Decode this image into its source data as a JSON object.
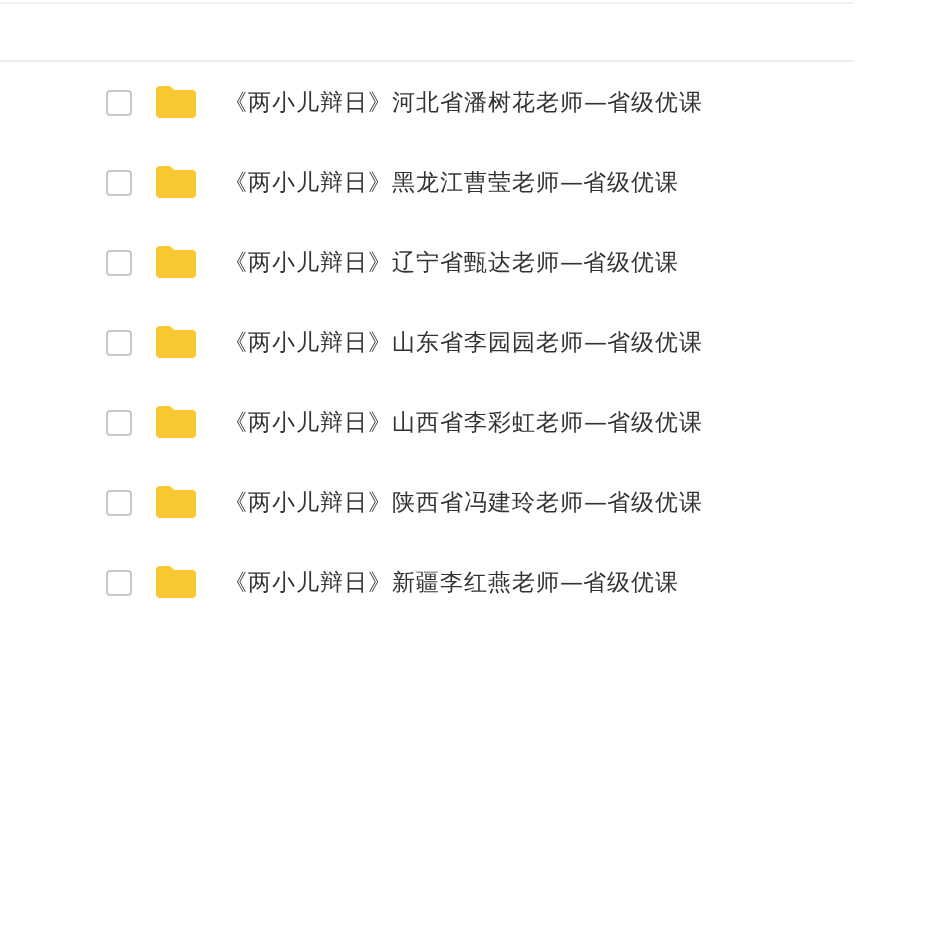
{
  "files": [
    {
      "name": "《两小儿辩日》河北省潘树花老师—省级优课",
      "kind": "folder",
      "checked": false
    },
    {
      "name": "《两小儿辩日》黑龙江曹莹老师—省级优课",
      "kind": "folder",
      "checked": false
    },
    {
      "name": "《两小儿辩日》辽宁省甄达老师—省级优课",
      "kind": "folder",
      "checked": false
    },
    {
      "name": "《两小儿辩日》山东省李园园老师—省级优课",
      "kind": "folder",
      "checked": false
    },
    {
      "name": "《两小儿辩日》山西省李彩虹老师—省级优课",
      "kind": "folder",
      "checked": false
    },
    {
      "name": "《两小儿辩日》陕西省冯建玲老师—省级优课",
      "kind": "folder",
      "checked": false
    },
    {
      "name": "《两小儿辩日》新疆李红燕老师—省级优课",
      "kind": "folder",
      "checked": false
    }
  ]
}
